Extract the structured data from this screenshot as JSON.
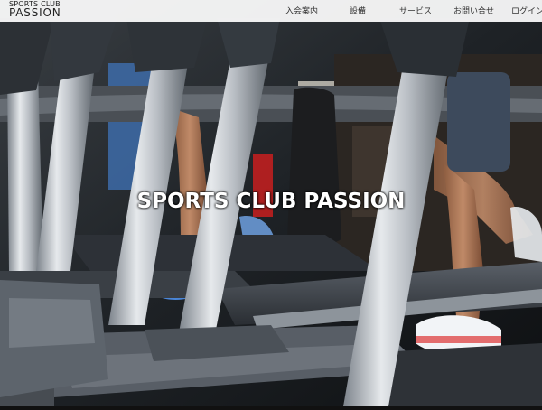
{
  "header": {
    "logo_small": "SPORTS CLUB",
    "logo_big": "PASSION",
    "nav": [
      {
        "label": "入会案内"
      },
      {
        "label": "設備"
      },
      {
        "label": "サービス"
      },
      {
        "label": "お問い合せ"
      },
      {
        "label": "ログイン"
      }
    ]
  },
  "hero": {
    "title": "SPORTS CLUB PASSION",
    "image": "treadmill-gym-photo"
  }
}
